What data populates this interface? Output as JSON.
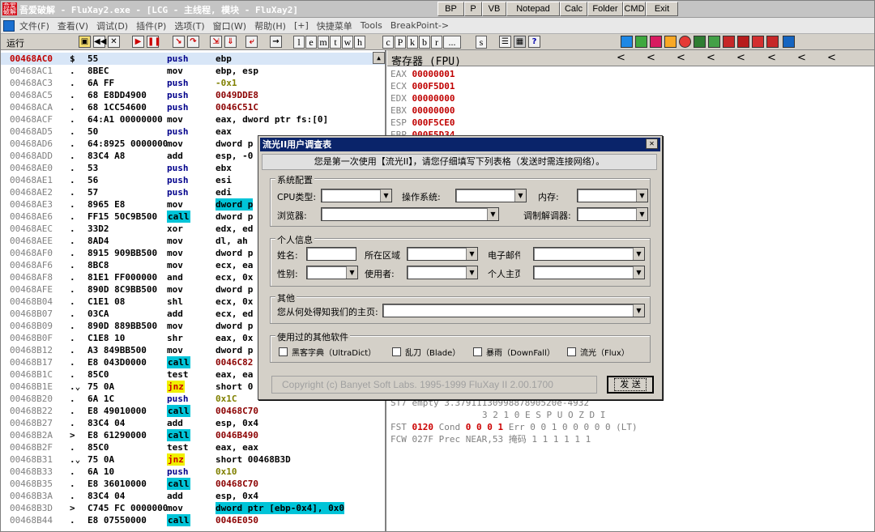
{
  "title": {
    "logo": "吾爱破解",
    "text": "吾爱破解 - FluXay2.exe - [LCG - 主线程, 模块 - FluXay2]"
  },
  "tool_buttons": [
    "BP",
    "P",
    "VB",
    "Notepad",
    "Calc",
    "Folder",
    "CMD",
    "Exit"
  ],
  "menu": [
    "文件(F)",
    "查看(V)",
    "调试(D)",
    "插件(P)",
    "选项(T)",
    "窗口(W)",
    "帮助(H)",
    "[+]",
    "快捷菜单",
    "Tools",
    "BreakPoint->"
  ],
  "toolbar": {
    "run_label": "运行",
    "letters": [
      "l",
      "e",
      "m",
      "t",
      "w",
      "h",
      "c",
      "P",
      "k",
      "b",
      "r",
      "...",
      "s"
    ]
  },
  "disasm": [
    {
      "addr": "00468AC0",
      "mark": "$",
      "hex": "55",
      "mn": "push",
      "op": "ebp"
    },
    {
      "addr": "00468AC1",
      "mark": ".",
      "hex": "8BEC",
      "mn": "mov",
      "op": "ebp, esp"
    },
    {
      "addr": "00468AC3",
      "mark": ".",
      "hex": "6A FF",
      "mn": "push",
      "op": "-0x1"
    },
    {
      "addr": "00468AC5",
      "mark": ".",
      "hex": "68 E8DD4900",
      "mn": "push",
      "op": "0049DDE8"
    },
    {
      "addr": "00468ACA",
      "mark": ".",
      "hex": "68 1CC54600",
      "mn": "push",
      "op": "0046C51C"
    },
    {
      "addr": "00468ACF",
      "mark": ".",
      "hex": "64:A1 00000000",
      "mn": "mov",
      "op": "eax, dword ptr fs:[0]"
    },
    {
      "addr": "00468AD5",
      "mark": ".",
      "hex": "50",
      "mn": "push",
      "op": "eax"
    },
    {
      "addr": "00468AD6",
      "mark": ".",
      "hex": "64:8925 00000000",
      "mn": "mov",
      "op": "dword p"
    },
    {
      "addr": "00468ADD",
      "mark": ".",
      "hex": "83C4 A8",
      "mn": "add",
      "op": "esp, -0"
    },
    {
      "addr": "00468AE0",
      "mark": ".",
      "hex": "53",
      "mn": "push",
      "op": "ebx"
    },
    {
      "addr": "00468AE1",
      "mark": ".",
      "hex": "56",
      "mn": "push",
      "op": "esi"
    },
    {
      "addr": "00468AE2",
      "mark": ".",
      "hex": "57",
      "mn": "push",
      "op": "edi"
    },
    {
      "addr": "00468AE3",
      "mark": ".",
      "hex": "8965 E8",
      "mn": "mov",
      "op": "dword p"
    },
    {
      "addr": "00468AE6",
      "mark": ".",
      "hex": "FF15 50C9B500",
      "mn": "call",
      "op": "dword p"
    },
    {
      "addr": "00468AEC",
      "mark": ".",
      "hex": "33D2",
      "mn": "xor",
      "op": "edx, ed"
    },
    {
      "addr": "00468AEE",
      "mark": ".",
      "hex": "8AD4",
      "mn": "mov",
      "op": "dl, ah"
    },
    {
      "addr": "00468AF0",
      "mark": ".",
      "hex": "8915 909BB500",
      "mn": "mov",
      "op": "dword p"
    },
    {
      "addr": "00468AF6",
      "mark": ".",
      "hex": "8BC8",
      "mn": "mov",
      "op": "ecx, ea"
    },
    {
      "addr": "00468AF8",
      "mark": ".",
      "hex": "81E1 FF000000",
      "mn": "and",
      "op": "ecx, 0x"
    },
    {
      "addr": "00468AFE",
      "mark": ".",
      "hex": "890D 8C9BB500",
      "mn": "mov",
      "op": "dword p"
    },
    {
      "addr": "00468B04",
      "mark": ".",
      "hex": "C1E1 08",
      "mn": "shl",
      "op": "ecx, 0x"
    },
    {
      "addr": "00468B07",
      "mark": ".",
      "hex": "03CA",
      "mn": "add",
      "op": "ecx, ed"
    },
    {
      "addr": "00468B09",
      "mark": ".",
      "hex": "890D 889BB500",
      "mn": "mov",
      "op": "dword p"
    },
    {
      "addr": "00468B0F",
      "mark": ".",
      "hex": "C1E8 10",
      "mn": "shr",
      "op": "eax, 0x"
    },
    {
      "addr": "00468B12",
      "mark": ".",
      "hex": "A3 849BB500",
      "mn": "mov",
      "op": "dword p"
    },
    {
      "addr": "00468B17",
      "mark": ".",
      "hex": "E8 043D0000",
      "mn": "call",
      "op": "0046C82"
    },
    {
      "addr": "00468B1C",
      "mark": ".",
      "hex": "85C0",
      "mn": "test",
      "op": "eax, ea"
    },
    {
      "addr": "00468B1E",
      "mark": ".⌄",
      "hex": "75 0A",
      "mn": "jnz",
      "op": "short 0"
    },
    {
      "addr": "00468B20",
      "mark": ".",
      "hex": "6A 1C",
      "mn": "push",
      "op": "0x1C"
    },
    {
      "addr": "00468B22",
      "mark": ".",
      "hex": "E8 49010000",
      "mn": "call",
      "op": "00468C70"
    },
    {
      "addr": "00468B27",
      "mark": ".",
      "hex": "83C4 04",
      "mn": "add",
      "op": "esp, 0x4"
    },
    {
      "addr": "00468B2A",
      "mark": ">",
      "hex": "E8 61290000",
      "mn": "call",
      "op": "0046B490"
    },
    {
      "addr": "00468B2F",
      "mark": ".",
      "hex": "85C0",
      "mn": "test",
      "op": "eax, eax"
    },
    {
      "addr": "00468B31",
      "mark": ".⌄",
      "hex": "75 0A",
      "mn": "jnz",
      "op": "short 00468B3D"
    },
    {
      "addr": "00468B33",
      "mark": ".",
      "hex": "6A 10",
      "mn": "push",
      "op": "0x10"
    },
    {
      "addr": "00468B35",
      "mark": ".",
      "hex": "E8 36010000",
      "mn": "call",
      "op": "00468C70"
    },
    {
      "addr": "00468B3A",
      "mark": ".",
      "hex": "83C4 04",
      "mn": "add",
      "op": "esp, 0x4"
    },
    {
      "addr": "00468B3D",
      "mark": ">",
      "hex": "C745 FC 00000000",
      "mn": "mov",
      "op": "dword ptr [ebp-0x4], 0x0"
    },
    {
      "addr": "00468B44",
      "mark": ".",
      "hex": "E8 07550000",
      "mn": "call",
      "op": "0046E050"
    }
  ],
  "registers": {
    "title": "寄存器 (FPU)",
    "arrows": [
      "<",
      "<",
      "<",
      "<",
      "<",
      "<",
      "<",
      "<"
    ],
    "list": [
      {
        "name": "EAX",
        "value": "00000001"
      },
      {
        "name": "ECX",
        "value": "000F5D01"
      },
      {
        "name": "EDX",
        "value": "00000000"
      },
      {
        "name": "EBX",
        "value": "00000000"
      },
      {
        "name": "ESP",
        "value": "000F5CE0"
      },
      {
        "name": "EBP",
        "value": "000F5D34"
      }
    ],
    "st7": "ST7 empty 3.3791113099887890520e-4932",
    "bits_line": "3 2 1 0        E S P U O Z D I",
    "fst": {
      "label": "FST",
      "value": "0120",
      "cond_label": "Cond",
      "cond": "0 0 0 1",
      "err": "Err 0 0 1 0 0 0 0 0  (LT)"
    },
    "fcw": {
      "label": "FCW 027F",
      "prec": "Prec NEAR,53",
      "mask_label": "掩码",
      "mask": "1 1 1 1 1 1"
    }
  },
  "dialog": {
    "title": "流光II用户调查表",
    "close": "✕",
    "notice": "您是第一次使用【流光II】，请您仔细填写下列表格（发送时需连接网络）。",
    "sys_group": "系统配置",
    "cpu_label": "CPU类型:",
    "os_label": "操作系统:",
    "mem_label": "内存:",
    "browser_label": "浏览器:",
    "modem_label": "调制解调器:",
    "personal_group": "个人信息",
    "name_label": "姓名:",
    "region_label": "所在区域:",
    "email_label": "电子邮件:",
    "gender_label": "性别:",
    "user_label": "使用者:",
    "homepage_label": "个人主页:",
    "other_group": "其他",
    "source_label": "您从何处得知我们的主页:",
    "used_group": "使用过的其他软件",
    "software": [
      "黑客字典（UltraDict）",
      "乱刀（Blade）",
      "暴雨（DownFall）",
      "流光（Flux）"
    ],
    "copyright": "Copyright (c) Banyet Soft Labs. 1995-1999  FluXay II 2.00.1700",
    "send": "发 送",
    "dropdown": "▼"
  }
}
